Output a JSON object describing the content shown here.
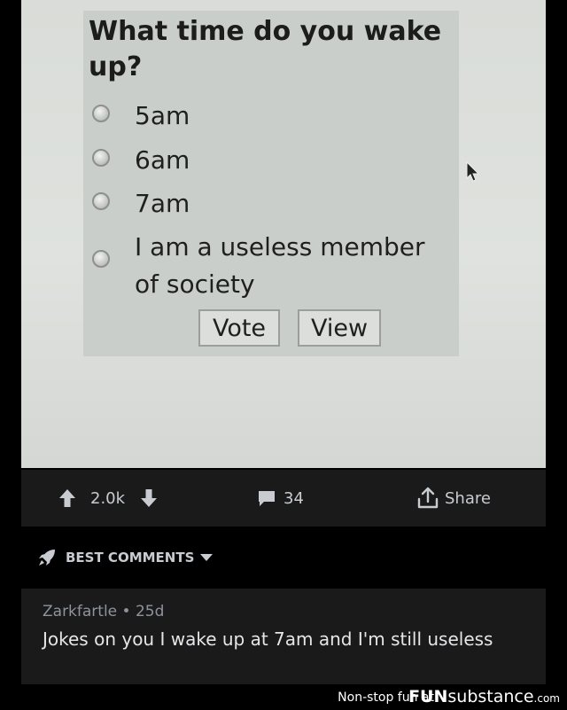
{
  "poll": {
    "question": "What time do you wake up?",
    "options": [
      {
        "label": "5am",
        "selected": false
      },
      {
        "label": "6am",
        "selected": false
      },
      {
        "label": "7am",
        "selected": false
      },
      {
        "label": "I am a useless member of society",
        "selected": false
      }
    ],
    "vote_label": "Vote",
    "view_label": "View"
  },
  "actions": {
    "upvote_count": "2.0k",
    "comment_count": "34",
    "share_label": "Share"
  },
  "comments_section": {
    "sort_label": "BEST COMMENTS"
  },
  "comment": {
    "author": "Zarkfartle",
    "separator": "•",
    "age": "25d",
    "body": "Jokes on you I wake up at 7am and I'm still useless"
  },
  "footer": {
    "tagline": "Non-stop fun at",
    "logo_bold": "FUN",
    "logo_rest": "substance",
    "logo_suffix": ".com"
  },
  "colors": {
    "page_bg": "#000000",
    "card_bg": "#1a1a1b",
    "photo_bg": "#dfe2de",
    "muted_text": "#8e949a",
    "body_text": "#e4e6e8"
  }
}
